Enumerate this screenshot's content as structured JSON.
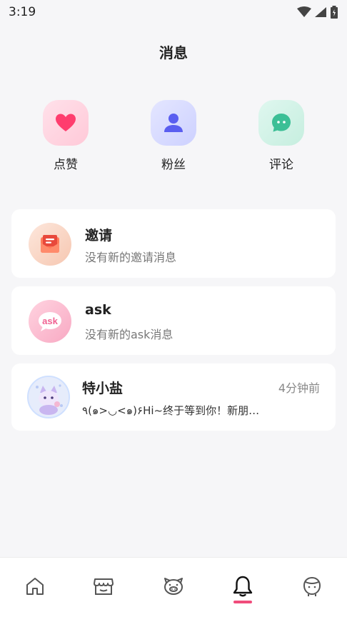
{
  "status_bar": {
    "time": "3:19"
  },
  "header": {
    "title": "消息"
  },
  "shortcuts": [
    {
      "label": "点赞",
      "icon": "heart-icon",
      "color": "#ff3d6e"
    },
    {
      "label": "粉丝",
      "icon": "person-icon",
      "color": "#5a5ef0"
    },
    {
      "label": "评论",
      "icon": "chat-bubble-icon",
      "color": "#3cbf96"
    }
  ],
  "messages": [
    {
      "title": "邀请",
      "subtitle": "没有新的邀请消息",
      "icon": "invitation-icon"
    },
    {
      "title": "ask",
      "subtitle": "没有新的ask消息",
      "icon": "ask-icon",
      "icon_text": "ask"
    },
    {
      "title": "特小盐",
      "subtitle": "٩(๑>◡<๑)۶Hi~终于等到你！新朋…",
      "time": "4分钟前",
      "icon": "user-avatar"
    }
  ],
  "tab_bar": {
    "tabs": [
      {
        "name": "home",
        "icon": "home-icon"
      },
      {
        "name": "shop",
        "icon": "store-icon"
      },
      {
        "name": "pet",
        "icon": "pig-face-icon"
      },
      {
        "name": "messages",
        "icon": "bell-icon",
        "active": true
      },
      {
        "name": "profile",
        "icon": "profile-face-icon"
      }
    ],
    "active_color": "#f04c7b"
  }
}
